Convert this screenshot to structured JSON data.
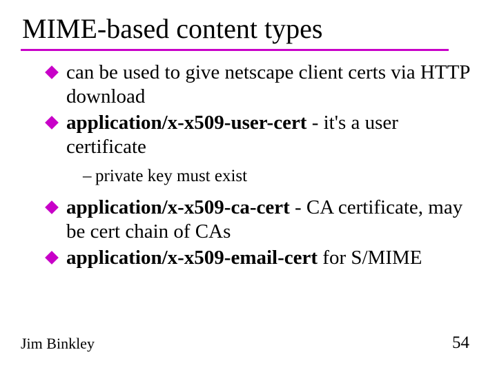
{
  "title": "MIME-based content types",
  "bullets": {
    "b1": "can be used to give netscape client certs via HTTP download",
    "b2_bold": "application/x-x509-user-cert",
    "b2_rest": " - it's a user certificate",
    "sub1": "private key must exist",
    "b3_bold": "application/x-x509-ca-cert",
    "b3_rest": " - CA certificate, may be cert chain of  CAs",
    "b4_bold": "application/x-x509-email-cert",
    "b4_rest": " for S/MIME"
  },
  "footer": {
    "author": "Jim Binkley",
    "page": "54"
  }
}
